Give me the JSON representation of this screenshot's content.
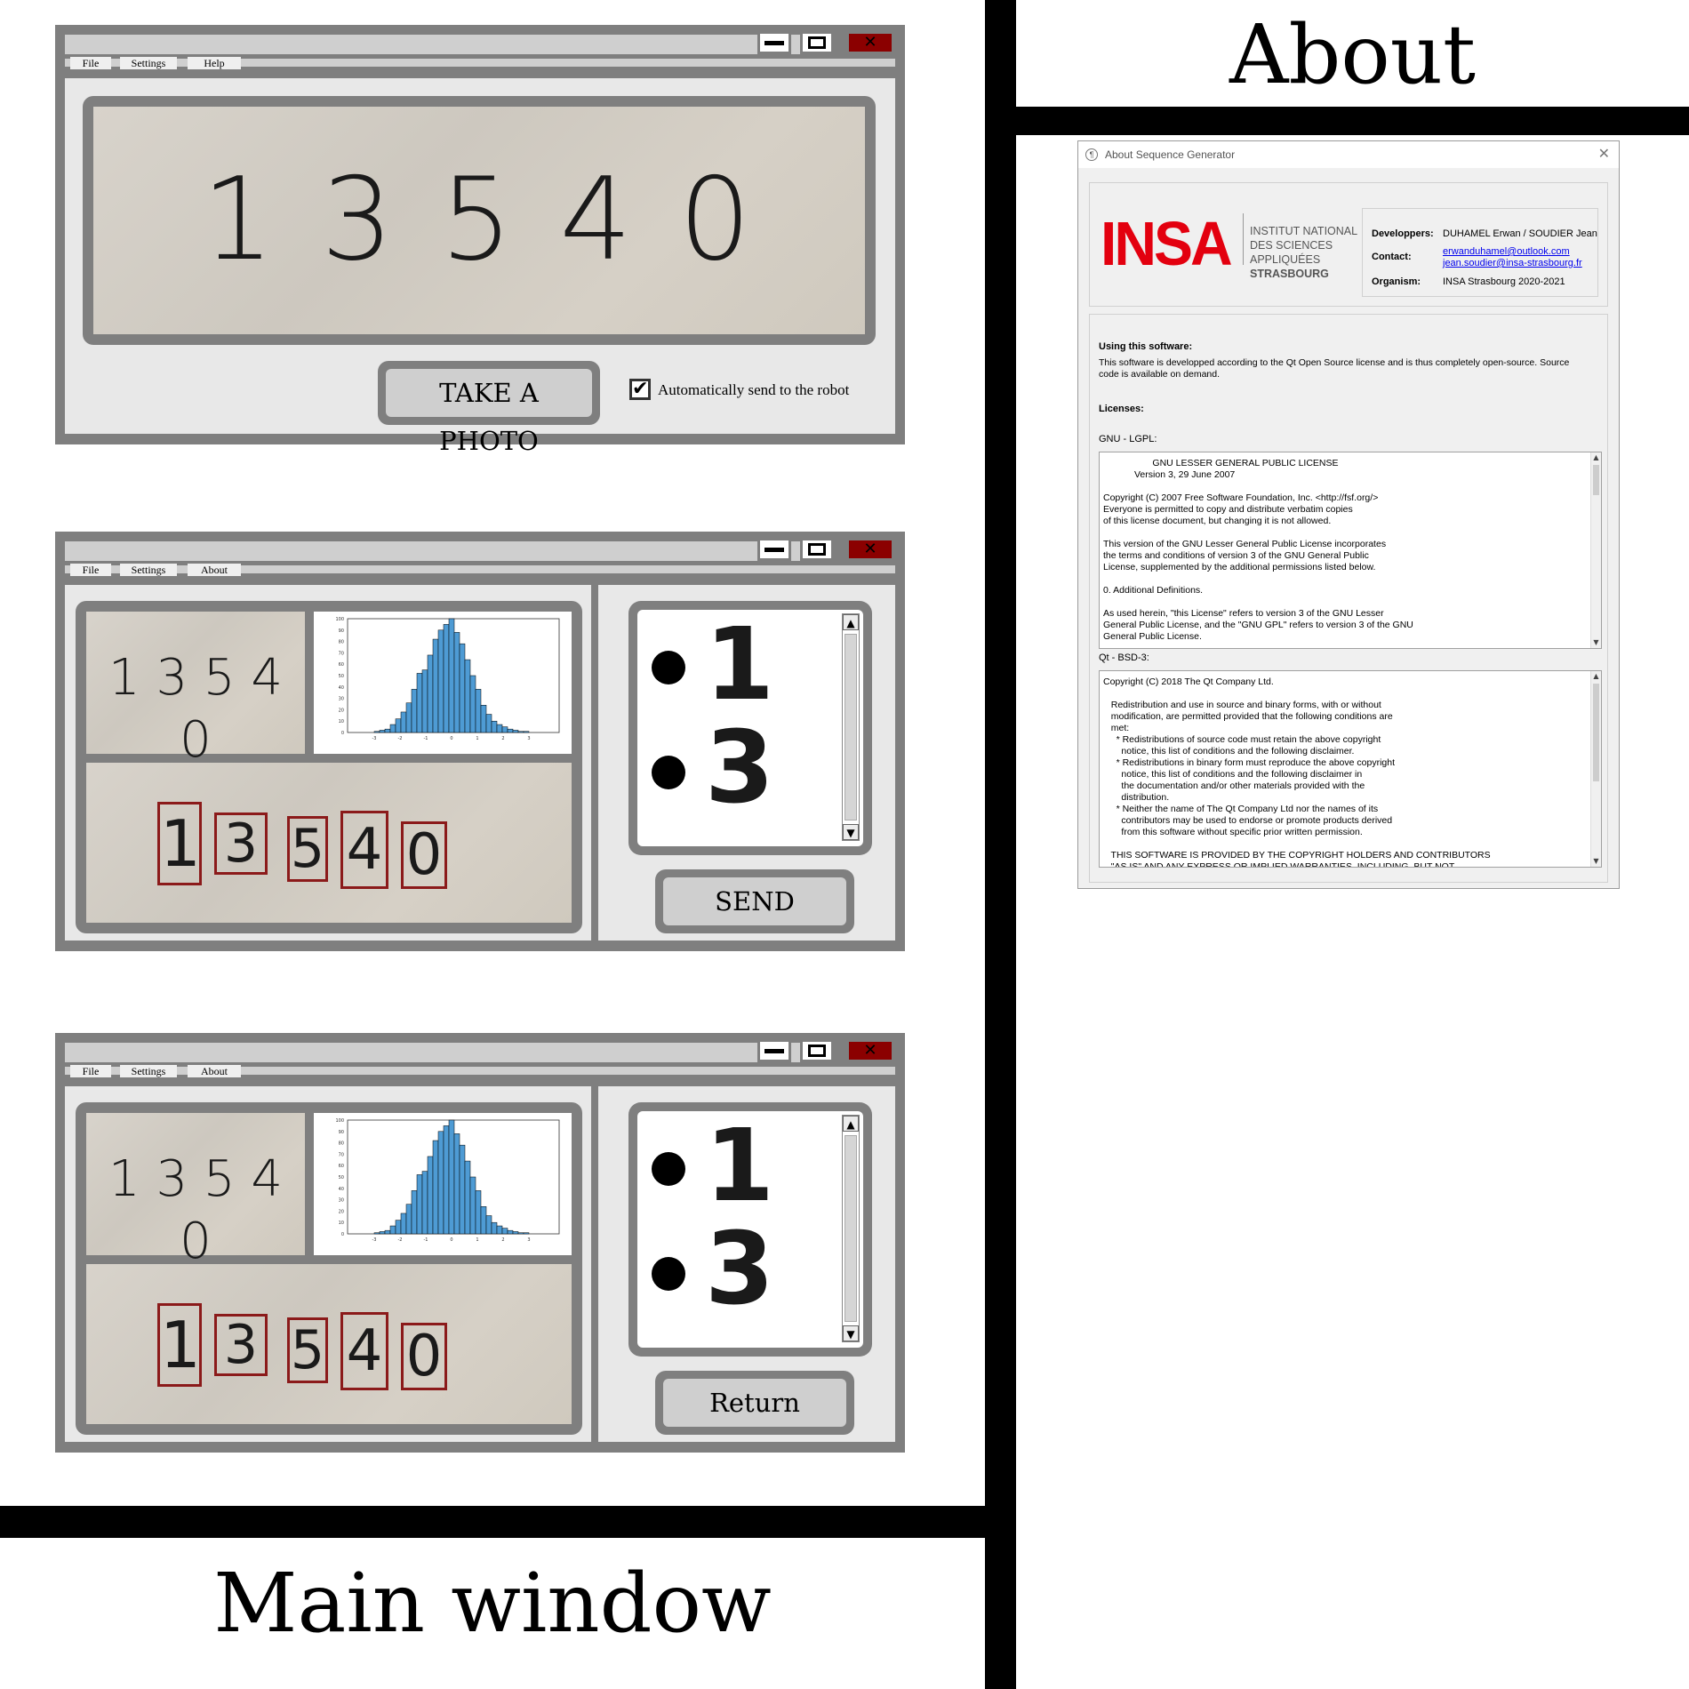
{
  "headings": {
    "about": "About",
    "main_window": "Main window"
  },
  "window1": {
    "menu": [
      "File",
      "Settings",
      "Help"
    ],
    "photo_number": "1 3 5 4 0",
    "take_photo_label": "TAKE A PHOTO",
    "auto_send_checked": true,
    "auto_send_label": "Automatically send to the robot"
  },
  "window2": {
    "menu": [
      "File",
      "Settings",
      "About"
    ],
    "photo_number": "1 3 5 4 0",
    "segmented_digits": [
      "1",
      "3",
      "5",
      "4",
      "0"
    ],
    "sequence_digits": [
      "1",
      "3"
    ],
    "action_label": "SEND"
  },
  "window3": {
    "menu": [
      "File",
      "Settings",
      "About"
    ],
    "photo_number": "1 3 5 4 0",
    "segmented_digits": [
      "1",
      "3",
      "5",
      "4",
      "0"
    ],
    "sequence_digits": [
      "1",
      "3"
    ],
    "action_label": "Return"
  },
  "histogram": {
    "bar_heights_pct": [
      1,
      2,
      3,
      7,
      12,
      18,
      26,
      38,
      52,
      55,
      68,
      82,
      90,
      95,
      100,
      88,
      78,
      64,
      50,
      38,
      24,
      16,
      10,
      7,
      5,
      3,
      2,
      1,
      1
    ],
    "yticks": [
      "100",
      "90",
      "80",
      "70",
      "60",
      "50",
      "40",
      "30",
      "20",
      "10",
      "0"
    ],
    "xticks": [
      "-3",
      "-2",
      "-1",
      "0",
      "1",
      "2",
      "3"
    ],
    "bar_color": "#4e9bd4"
  },
  "about_dialog": {
    "title": "About Sequence Generator",
    "close_glyph": "✕",
    "logo_text": "INSA",
    "institute_lines": [
      "INSTITUT NATIONAL",
      "DES SCIENCES",
      "APPLIQUÉES",
      "STRASBOURG"
    ],
    "developers_label": "Developpers:",
    "developers_value": "DUHAMEL Erwan / SOUDIER Jean",
    "contact_label": "Contact:",
    "contact_emails": [
      "erwanduhamel@outlook.com",
      "jean.soudier@insa-strasbourg.fr"
    ],
    "organism_label": "Organism:",
    "organism_value": "INSA Strasbourg 2020-2021",
    "using_heading": "Using this software:",
    "using_text_1": "This software is developped according to the Qt Open Source license and is thus completely open-source. Source",
    "using_text_2": "code is available on demand.",
    "licenses_heading": "Licenses:",
    "lgpl_label": "GNU - LGPL:",
    "lgpl_text": "                   GNU LESSER GENERAL PUBLIC LICENSE\n            Version 3, 29 June 2007\n\nCopyright (C) 2007 Free Software Foundation, Inc. <http://fsf.org/>\nEveryone is permitted to copy and distribute verbatim copies\nof this license document, but changing it is not allowed.\n\nThis version of the GNU Lesser General Public License incorporates\nthe terms and conditions of version 3 of the GNU General Public\nLicense, supplemented by the additional permissions listed below.\n\n0. Additional Definitions.\n\nAs used herein, \"this License\" refers to version 3 of the GNU Lesser\nGeneral Public License, and the \"GNU GPL\" refers to version 3 of the GNU\nGeneral Public License.",
    "bsd_label": "Qt - BSD-3:",
    "bsd_text": "Copyright (C) 2018 The Qt Company Ltd.\n\n   Redistribution and use in source and binary forms, with or without\n   modification, are permitted provided that the following conditions are\n   met:\n     * Redistributions of source code must retain the above copyright\n       notice, this list of conditions and the following disclaimer.\n     * Redistributions in binary form must reproduce the above copyright\n       notice, this list of conditions and the following disclaimer in\n       the documentation and/or other materials provided with the\n       distribution.\n     * Neither the name of The Qt Company Ltd nor the names of its\n       contributors may be used to endorse or promote products derived\n       from this software without specific prior written permission.\n\n   THIS SOFTWARE IS PROVIDED BY THE COPYRIGHT HOLDERS AND CONTRIBUTORS\n   \"AS IS\" AND ANY EXPRESS OR IMPLIED WARRANTIES, INCLUDING, BUT NOT"
  }
}
